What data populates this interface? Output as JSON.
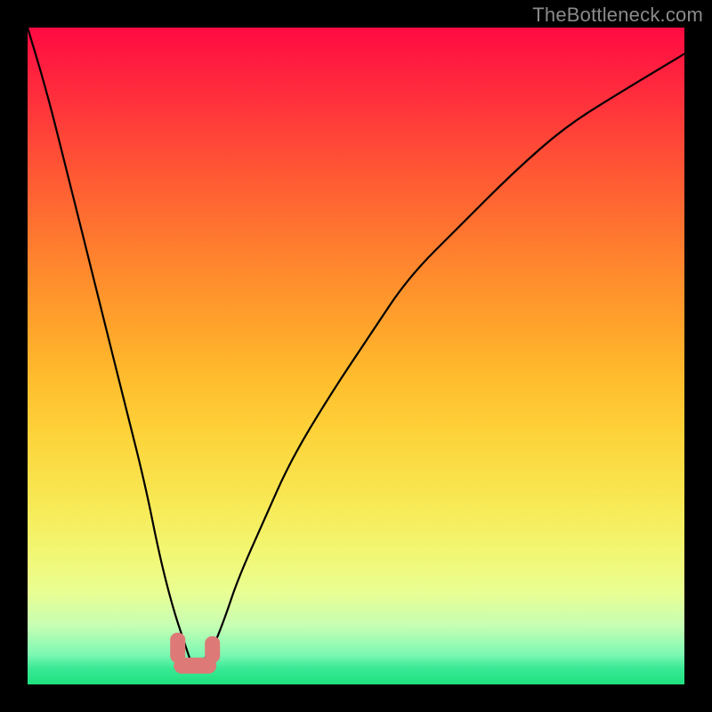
{
  "watermark": {
    "text": "TheBottleneck.com"
  },
  "chart_data": {
    "type": "line",
    "title": "",
    "xlabel": "",
    "ylabel": "",
    "xlim": [
      0,
      100
    ],
    "ylim": [
      0,
      100
    ],
    "grid": false,
    "series": [
      {
        "name": "bottleneck-curve",
        "x": [
          0,
          3,
          6,
          9,
          12,
          15,
          18,
          20,
          22,
          24,
          25,
          26,
          28,
          30,
          32,
          36,
          40,
          46,
          52,
          58,
          66,
          74,
          82,
          90,
          100
        ],
        "y": [
          100,
          90,
          78,
          66,
          54,
          42,
          30,
          20,
          12,
          6,
          3,
          3,
          5,
          10,
          16,
          25,
          34,
          44,
          53,
          62,
          70,
          78,
          85,
          90,
          96
        ]
      }
    ],
    "markers": [
      {
        "name": "trough-marker",
        "x": 25.5,
        "y": 3,
        "shape": "rounded-bar",
        "color": "#dd7a78"
      }
    ],
    "background": {
      "type": "vertical-gradient",
      "stops": [
        {
          "pos": 0,
          "color": "#ff0a42"
        },
        {
          "pos": 0.3,
          "color": "#ff7230"
        },
        {
          "pos": 0.62,
          "color": "#fdd33a"
        },
        {
          "pos": 0.86,
          "color": "#e9fe93"
        },
        {
          "pos": 1.0,
          "color": "#1ee17f"
        }
      ]
    }
  }
}
